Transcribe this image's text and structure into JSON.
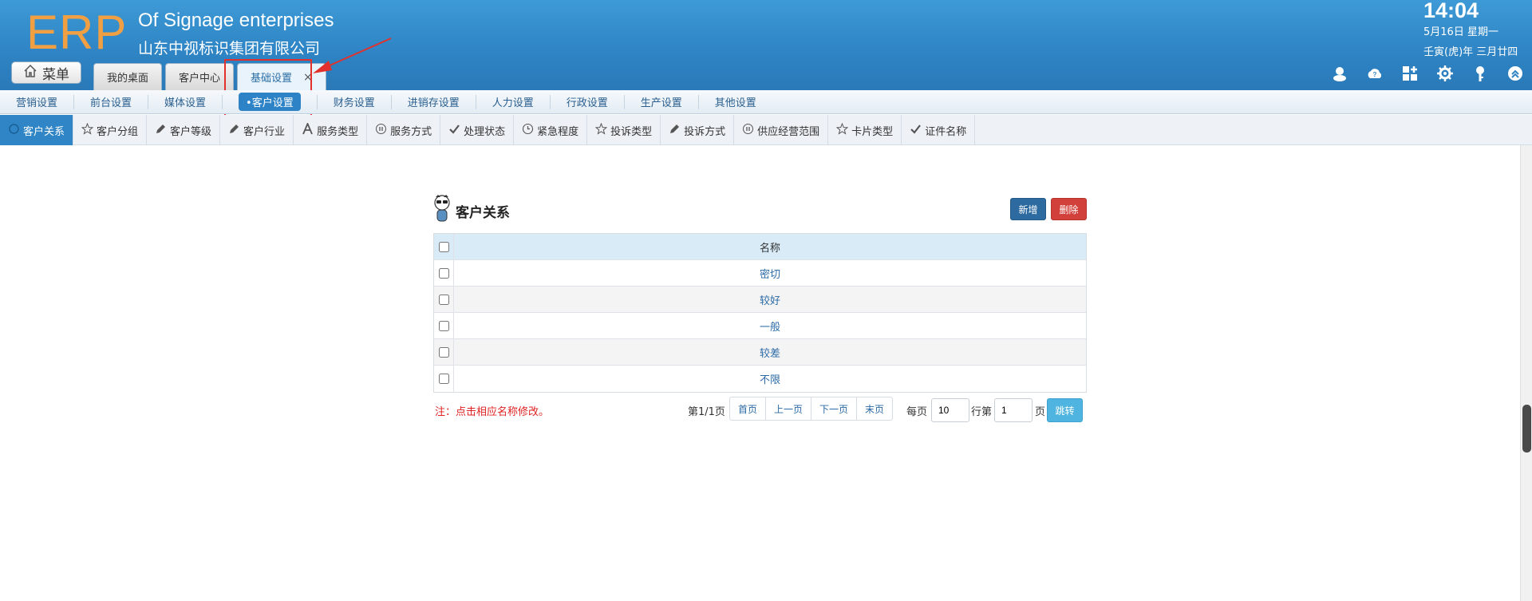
{
  "header": {
    "logo": "ERP",
    "company_en": "Of Signage enterprises",
    "company_cn": "山东中视标识集团有限公司",
    "time": "14:04",
    "date": "5月16日 星期一",
    "lunar": "壬寅(虎)年 三月廿四",
    "menu_label": "菜单"
  },
  "tabs": [
    {
      "label": "我的桌面"
    },
    {
      "label": "客户中心"
    },
    {
      "label": "基础设置",
      "close": "×",
      "active": true
    }
  ],
  "top_icons": [
    "user-icon",
    "help-cloud-icon",
    "apps-icon",
    "gear-icon",
    "key-icon",
    "collapse-icon"
  ],
  "nav2": [
    {
      "label": "营销设置"
    },
    {
      "label": "前台设置"
    },
    {
      "label": "媒体设置"
    },
    {
      "label": "•客户设置",
      "active": true
    },
    {
      "label": "财务设置"
    },
    {
      "label": "进销存设置"
    },
    {
      "label": "人力设置"
    },
    {
      "label": "行政设置"
    },
    {
      "label": "生产设置"
    },
    {
      "label": "其他设置"
    }
  ],
  "nav3": [
    {
      "label": "客户关系",
      "icon": "circle-icon",
      "active": true
    },
    {
      "label": "客户分组",
      "icon": "star-icon"
    },
    {
      "label": "客户等级",
      "icon": "pencil-icon"
    },
    {
      "label": "客户行业",
      "icon": "pencil-icon"
    },
    {
      "label": "服务类型",
      "icon": "font-icon"
    },
    {
      "label": "服务方式",
      "icon": "pause-icon"
    },
    {
      "label": "处理状态",
      "icon": "check-icon"
    },
    {
      "label": "紧急程度",
      "icon": "clock-icon"
    },
    {
      "label": "投诉类型",
      "icon": "star-icon"
    },
    {
      "label": "投诉方式",
      "icon": "pencil-icon"
    },
    {
      "label": "供应经营范围",
      "icon": "pause-icon"
    },
    {
      "label": "卡片类型",
      "icon": "star-icon"
    },
    {
      "label": "证件名称",
      "icon": "check-icon"
    }
  ],
  "panel": {
    "title": "客户关系",
    "add_label": "新增",
    "delete_label": "删除"
  },
  "table": {
    "header": "名称",
    "rows": [
      "密切",
      "较好",
      "一般",
      "较差",
      "不限"
    ]
  },
  "footer": {
    "note": "注：点击相应名称修改。",
    "page_info": "第1/1页",
    "first": "首页",
    "prev": "上一页",
    "next": "下一页",
    "last": "末页",
    "per_page_label": "每页",
    "per_page_value": "10",
    "row_label": "行第",
    "page_value": "1",
    "page_label": "页",
    "go_label": "跳转"
  },
  "colors": {
    "header": "#2f85c5",
    "logo": "#f0a043",
    "active": "#2f85c5",
    "add": "#2c6aa0",
    "delete": "#d2403b",
    "go": "#4fb5e0",
    "note": "#e02222"
  }
}
